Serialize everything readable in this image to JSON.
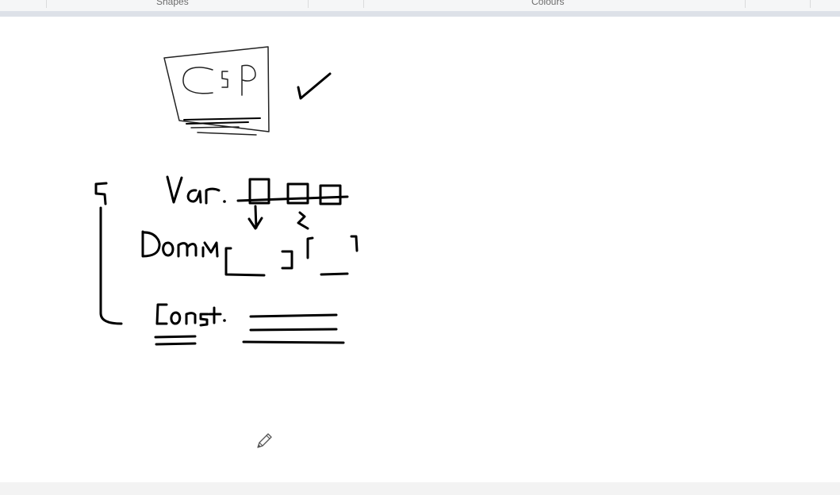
{
  "ribbon": {
    "group_labels": [
      "Shapes",
      "Colours"
    ]
  },
  "canvas": {
    "ink_color": "#000000"
  },
  "icons": {
    "cursor": "pencil-icon"
  }
}
